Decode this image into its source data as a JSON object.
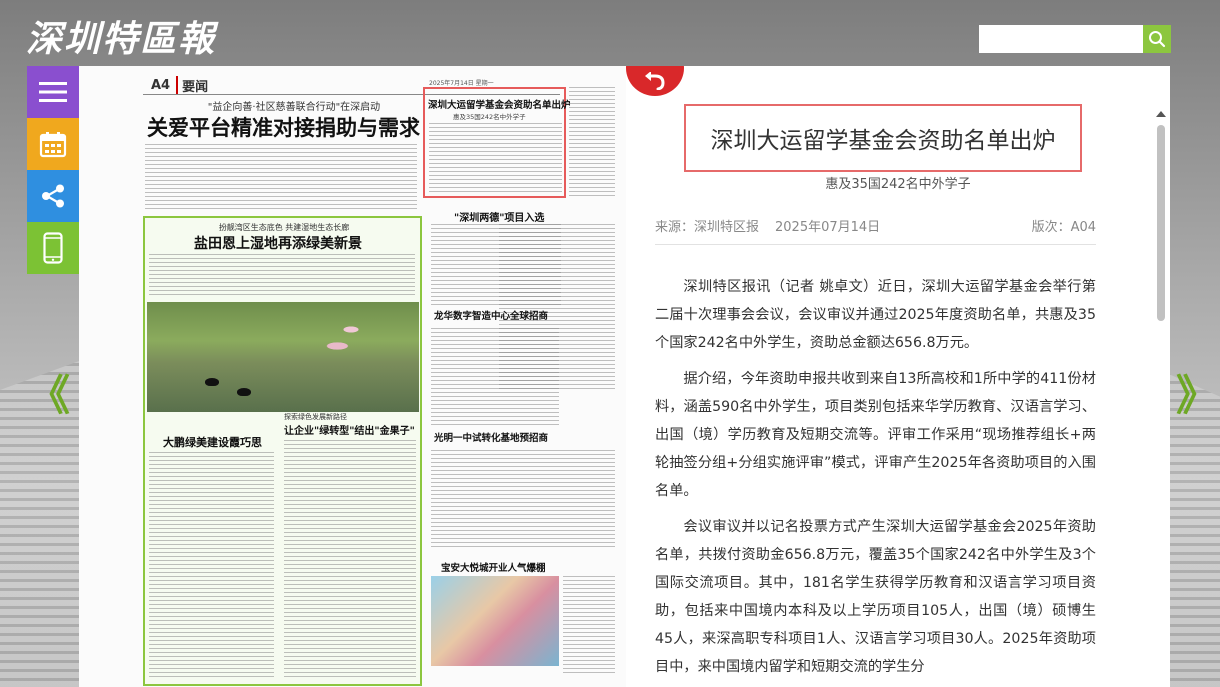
{
  "header": {
    "logo_text": "深圳特區報",
    "search": {
      "value": "",
      "placeholder": ""
    }
  },
  "colors": {
    "accent_green": "#8cc63f",
    "highlight_red": "#e65b5b",
    "menu_purple": "#8a4fcf",
    "calendar_orange": "#f0a81e",
    "share_blue": "#2f8fe0",
    "mobile_green": "#7cc234"
  },
  "side_tools": [
    {
      "name": "menu-icon"
    },
    {
      "name": "calendar-icon"
    },
    {
      "name": "share-icon"
    },
    {
      "name": "mobile-icon"
    }
  ],
  "nav": {
    "prev": "《",
    "next": "》"
  },
  "newspaper": {
    "page_no": "A4",
    "section": "要闻",
    "dateline": "2025年7月14日 星期一",
    "kicker_main": "\"益企向善·社区慈善联合行动\"在深启动",
    "headline_main": "关爱平台精准对接捐助与需求",
    "highlighted_headline": "深圳大运留学基金会资助名单出炉",
    "highlighted_sub": "惠及35国242名中外学子",
    "kicker_green": "扮靓湾区生态底色 共建湿地生态长廊",
    "headline_green": "盐田恩上湿地再添绿美新景",
    "headline_green_lower": "大鹏绿美建设霞巧思",
    "headline_center": "让企业\"绿转型\"结出\"金果子\"",
    "kicker_center": "探索绿色发展新路径",
    "headline_right1": "\"深圳两德\"项目入选",
    "headline_right2": "龙华数字智造中心全球招商",
    "headline_right3": "光明一中试转化基地预招商",
    "headline_right4": "宝安大悦城开业人气爆棚"
  },
  "article": {
    "title": "深圳大运留学基金会资助名单出炉",
    "subtitle": "惠及35国242名中外学子",
    "source": "来源：深圳特区报",
    "date": "2025年07月14日",
    "edition": "版次：A04",
    "paragraphs": [
      "深圳特区报讯（记者 姚卓文）近日，深圳大运留学基金会举行第二届十次理事会会议，会议审议并通过2025年度资助名单，共惠及35个国家242名中外学生，资助总金额达656.8万元。",
      "据介绍，今年资助申报共收到来自13所高校和1所中学的411份材料，涵盖590名中外学生，项目类别包括来华学历教育、汉语言学习、出国（境）学历教育及短期交流等。评审工作采用“现场推荐组长+两轮抽签分组+分组实施评审”模式，评审产生2025年各资助项目的入围名单。",
      "会议审议并以记名投票方式产生深圳大运留学基金会2025年资助名单，共拨付资助金656.8万元，覆盖35个国家242名中外学生及3个国际交流项目。其中，181名学生获得学历教育和汉语言学习项目资助，包括来中国境内本科及以上学历项目105人，出国（境）硕博生45人，来深高职专科项目1人、汉语言学习项目30人。2025年资助项目中，来中国境内留学和短期交流的学生分"
    ]
  }
}
